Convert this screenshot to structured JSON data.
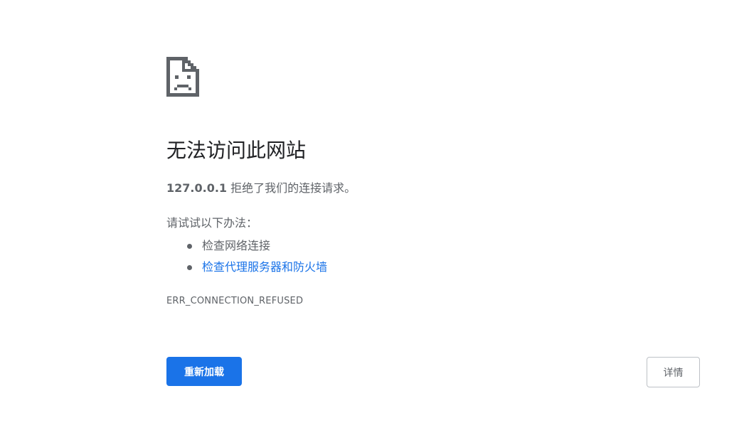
{
  "error": {
    "title": "无法访问此网站",
    "host": "127.0.0.1",
    "summary_suffix": " 拒绝了我们的连接请求。",
    "suggestions_heading": "请试试以下办法：",
    "suggestions": [
      {
        "label": "检查网络连接",
        "is_link": false
      },
      {
        "label": "检查代理服务器和防火墙",
        "is_link": true
      }
    ],
    "code": "ERR_CONNECTION_REFUSED",
    "icon": "sad-page-icon"
  },
  "buttons": {
    "reload_label": "重新加载",
    "details_label": "详情"
  },
  "colors": {
    "primary": "#1a73e8",
    "text": "#5f6368",
    "heading": "#202124",
    "icon": "#5f6368"
  }
}
